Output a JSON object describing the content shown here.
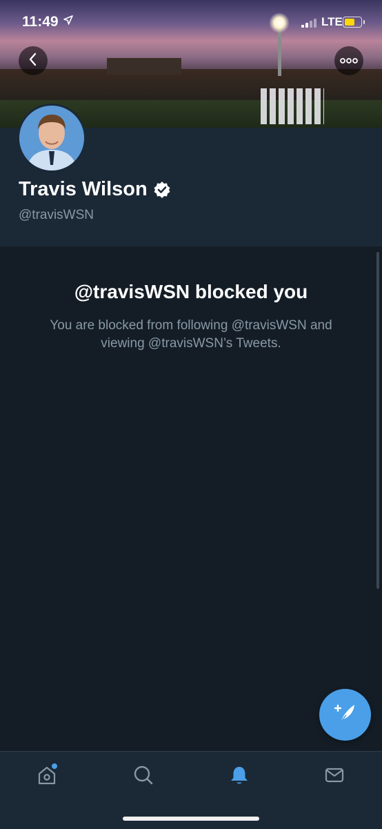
{
  "status_bar": {
    "time": "11:49",
    "location_icon": "location-arrow-icon",
    "network": "LTE",
    "battery_color": "#ffd60a"
  },
  "header": {
    "back_icon": "chevron-left-icon",
    "more_icon": "more-horizontal-icon"
  },
  "profile": {
    "display_name": "Travis Wilson",
    "verified_icon": "verified-badge-icon",
    "handle": "@travisWSN"
  },
  "blocked": {
    "title": "@travisWSN blocked you",
    "description": "You are blocked from following @travisWSN and viewing @travisWSN’s Tweets."
  },
  "compose": {
    "icon": "compose-tweet-icon"
  },
  "tab_bar": {
    "tabs": [
      {
        "name": "home",
        "icon": "home-icon",
        "active": false,
        "has_dot": true
      },
      {
        "name": "search",
        "icon": "search-icon",
        "active": false
      },
      {
        "name": "notifications",
        "icon": "bell-icon",
        "active": true
      },
      {
        "name": "messages",
        "icon": "mail-icon",
        "active": false
      }
    ]
  },
  "colors": {
    "accent": "#4a9fe8",
    "background": "#141d26",
    "profile_background": "#1b2836",
    "secondary_text": "#8899a6"
  }
}
